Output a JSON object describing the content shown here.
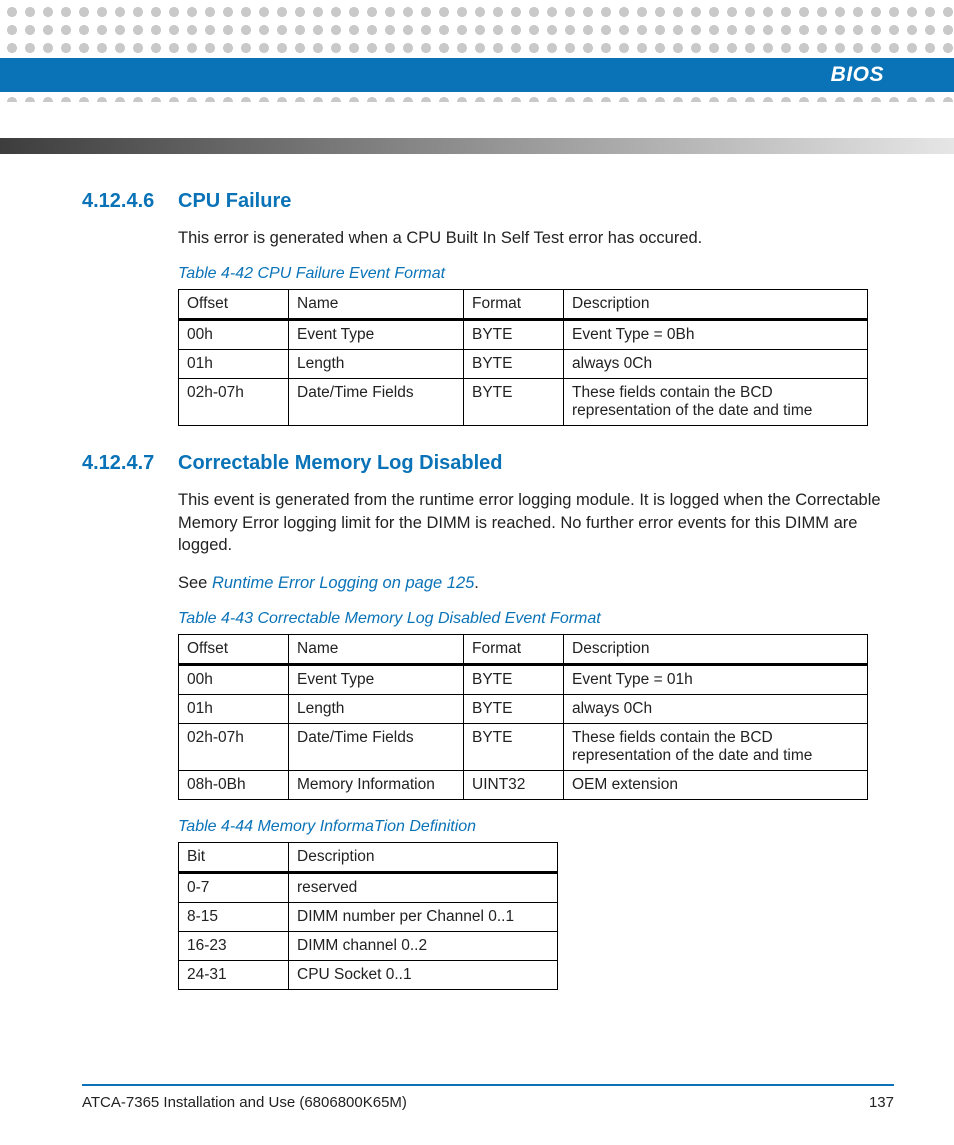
{
  "header": {
    "chapter_label": "BIOS"
  },
  "section1": {
    "number": "4.12.4.6",
    "title": "CPU Failure",
    "para": "This error is generated when a CPU Built In Self Test error has occured."
  },
  "table42": {
    "caption": "Table 4-42 CPU Failure Event Format",
    "headers": [
      "Offset",
      "Name",
      "Format",
      "Description"
    ],
    "rows": [
      [
        "00h",
        "Event Type",
        "BYTE",
        "Event Type = 0Bh"
      ],
      [
        "01h",
        "Length",
        "BYTE",
        "always 0Ch"
      ],
      [
        "02h-07h",
        "Date/Time Fields",
        "BYTE",
        "These fields contain the BCD representation of the date and time"
      ]
    ]
  },
  "section2": {
    "number": "4.12.4.7",
    "title": "Correctable Memory Log Disabled",
    "para": "This event is generated from the runtime error logging module. It is logged when the Correctable Memory Error logging limit for the DIMM is reached. No further error events for this DIMM are logged.",
    "see_prefix": "See ",
    "see_link": "Runtime Error Logging on page 125",
    "see_suffix": "."
  },
  "table43": {
    "caption": "Table 4-43 Correctable Memory Log Disabled Event Format",
    "headers": [
      "Offset",
      "Name",
      "Format",
      "Description"
    ],
    "rows": [
      [
        "00h",
        "Event Type",
        "BYTE",
        "Event Type = 01h"
      ],
      [
        "01h",
        "Length",
        "BYTE",
        "always 0Ch"
      ],
      [
        "02h-07h",
        "Date/Time Fields",
        "BYTE",
        "These fields contain the BCD representation of the date and time"
      ],
      [
        "08h-0Bh",
        "Memory Information",
        "UINT32",
        "OEM extension"
      ]
    ]
  },
  "table44": {
    "caption": "Table 4-44 Memory InformaTion Definition",
    "headers": [
      "Bit",
      "Description"
    ],
    "rows": [
      [
        "0-7",
        "reserved"
      ],
      [
        "8-15",
        "DIMM number per Channel 0..1"
      ],
      [
        "16-23",
        "DIMM channel 0..2"
      ],
      [
        "24-31",
        "CPU Socket 0..1"
      ]
    ]
  },
  "footer": {
    "doc_title": "ATCA-7365 Installation and Use (6806800K65M)",
    "page_number": "137"
  }
}
